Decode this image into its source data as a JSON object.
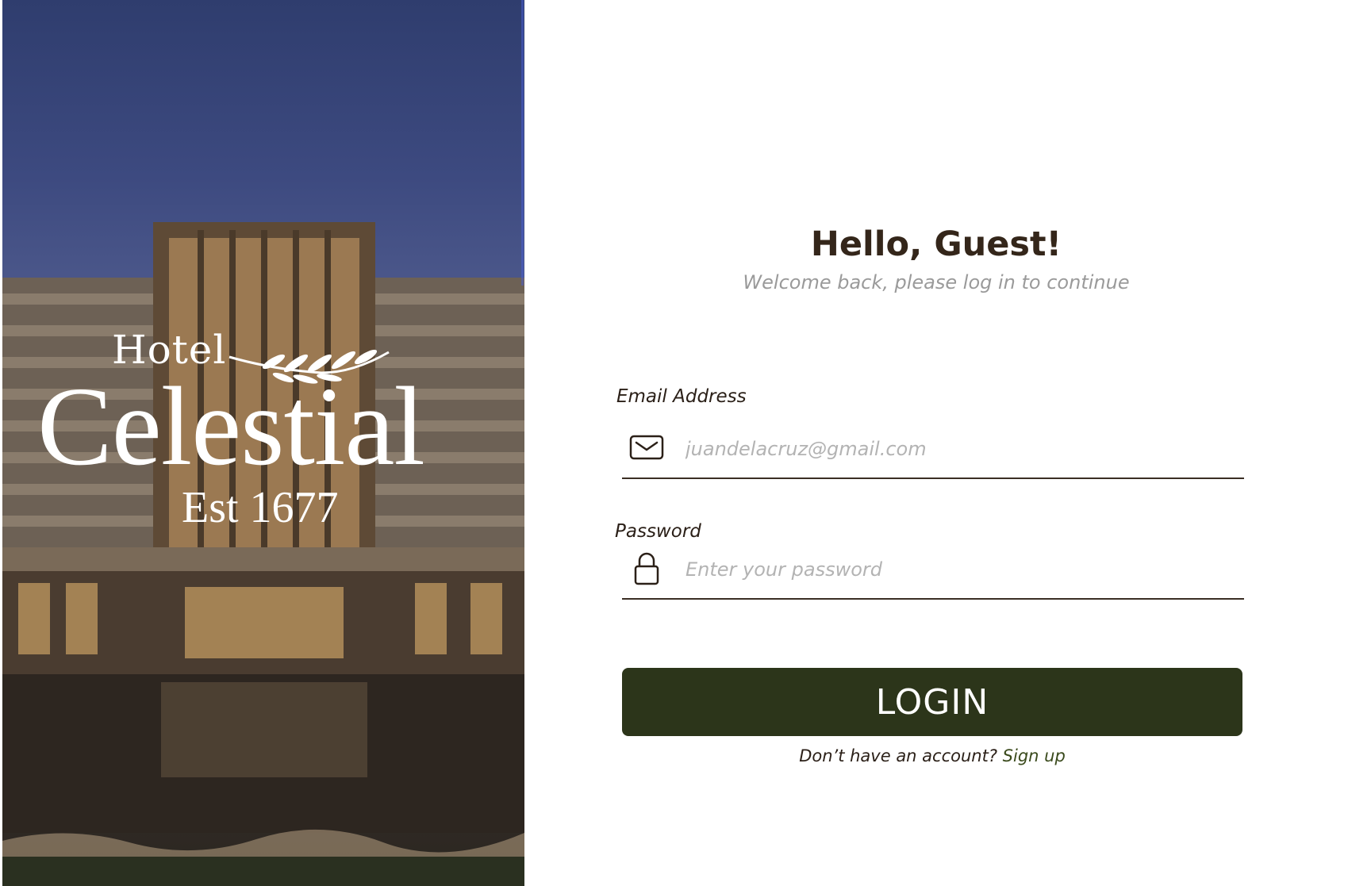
{
  "hero": {
    "logo_line1": "Hotel",
    "logo_line2": "Celestial",
    "logo_line3": "Est 1677"
  },
  "form": {
    "greeting": "Hello, Guest!",
    "subtitle": "Welcome back, please log in to continue",
    "email": {
      "label": "Email Address",
      "placeholder": "juandelacruz@gmail.com",
      "icon": "envelope-icon"
    },
    "password": {
      "label": "Password",
      "placeholder": "Enter your password",
      "icon": "lock-icon"
    },
    "login_label": "LOGIN",
    "signup_prompt": "Don’t have an account?",
    "signup_link": "Sign up"
  },
  "colors": {
    "heading": "#34261a",
    "button_bg": "#2c351a",
    "link": "#3a4a1c",
    "placeholder": "#b3b3b3"
  }
}
